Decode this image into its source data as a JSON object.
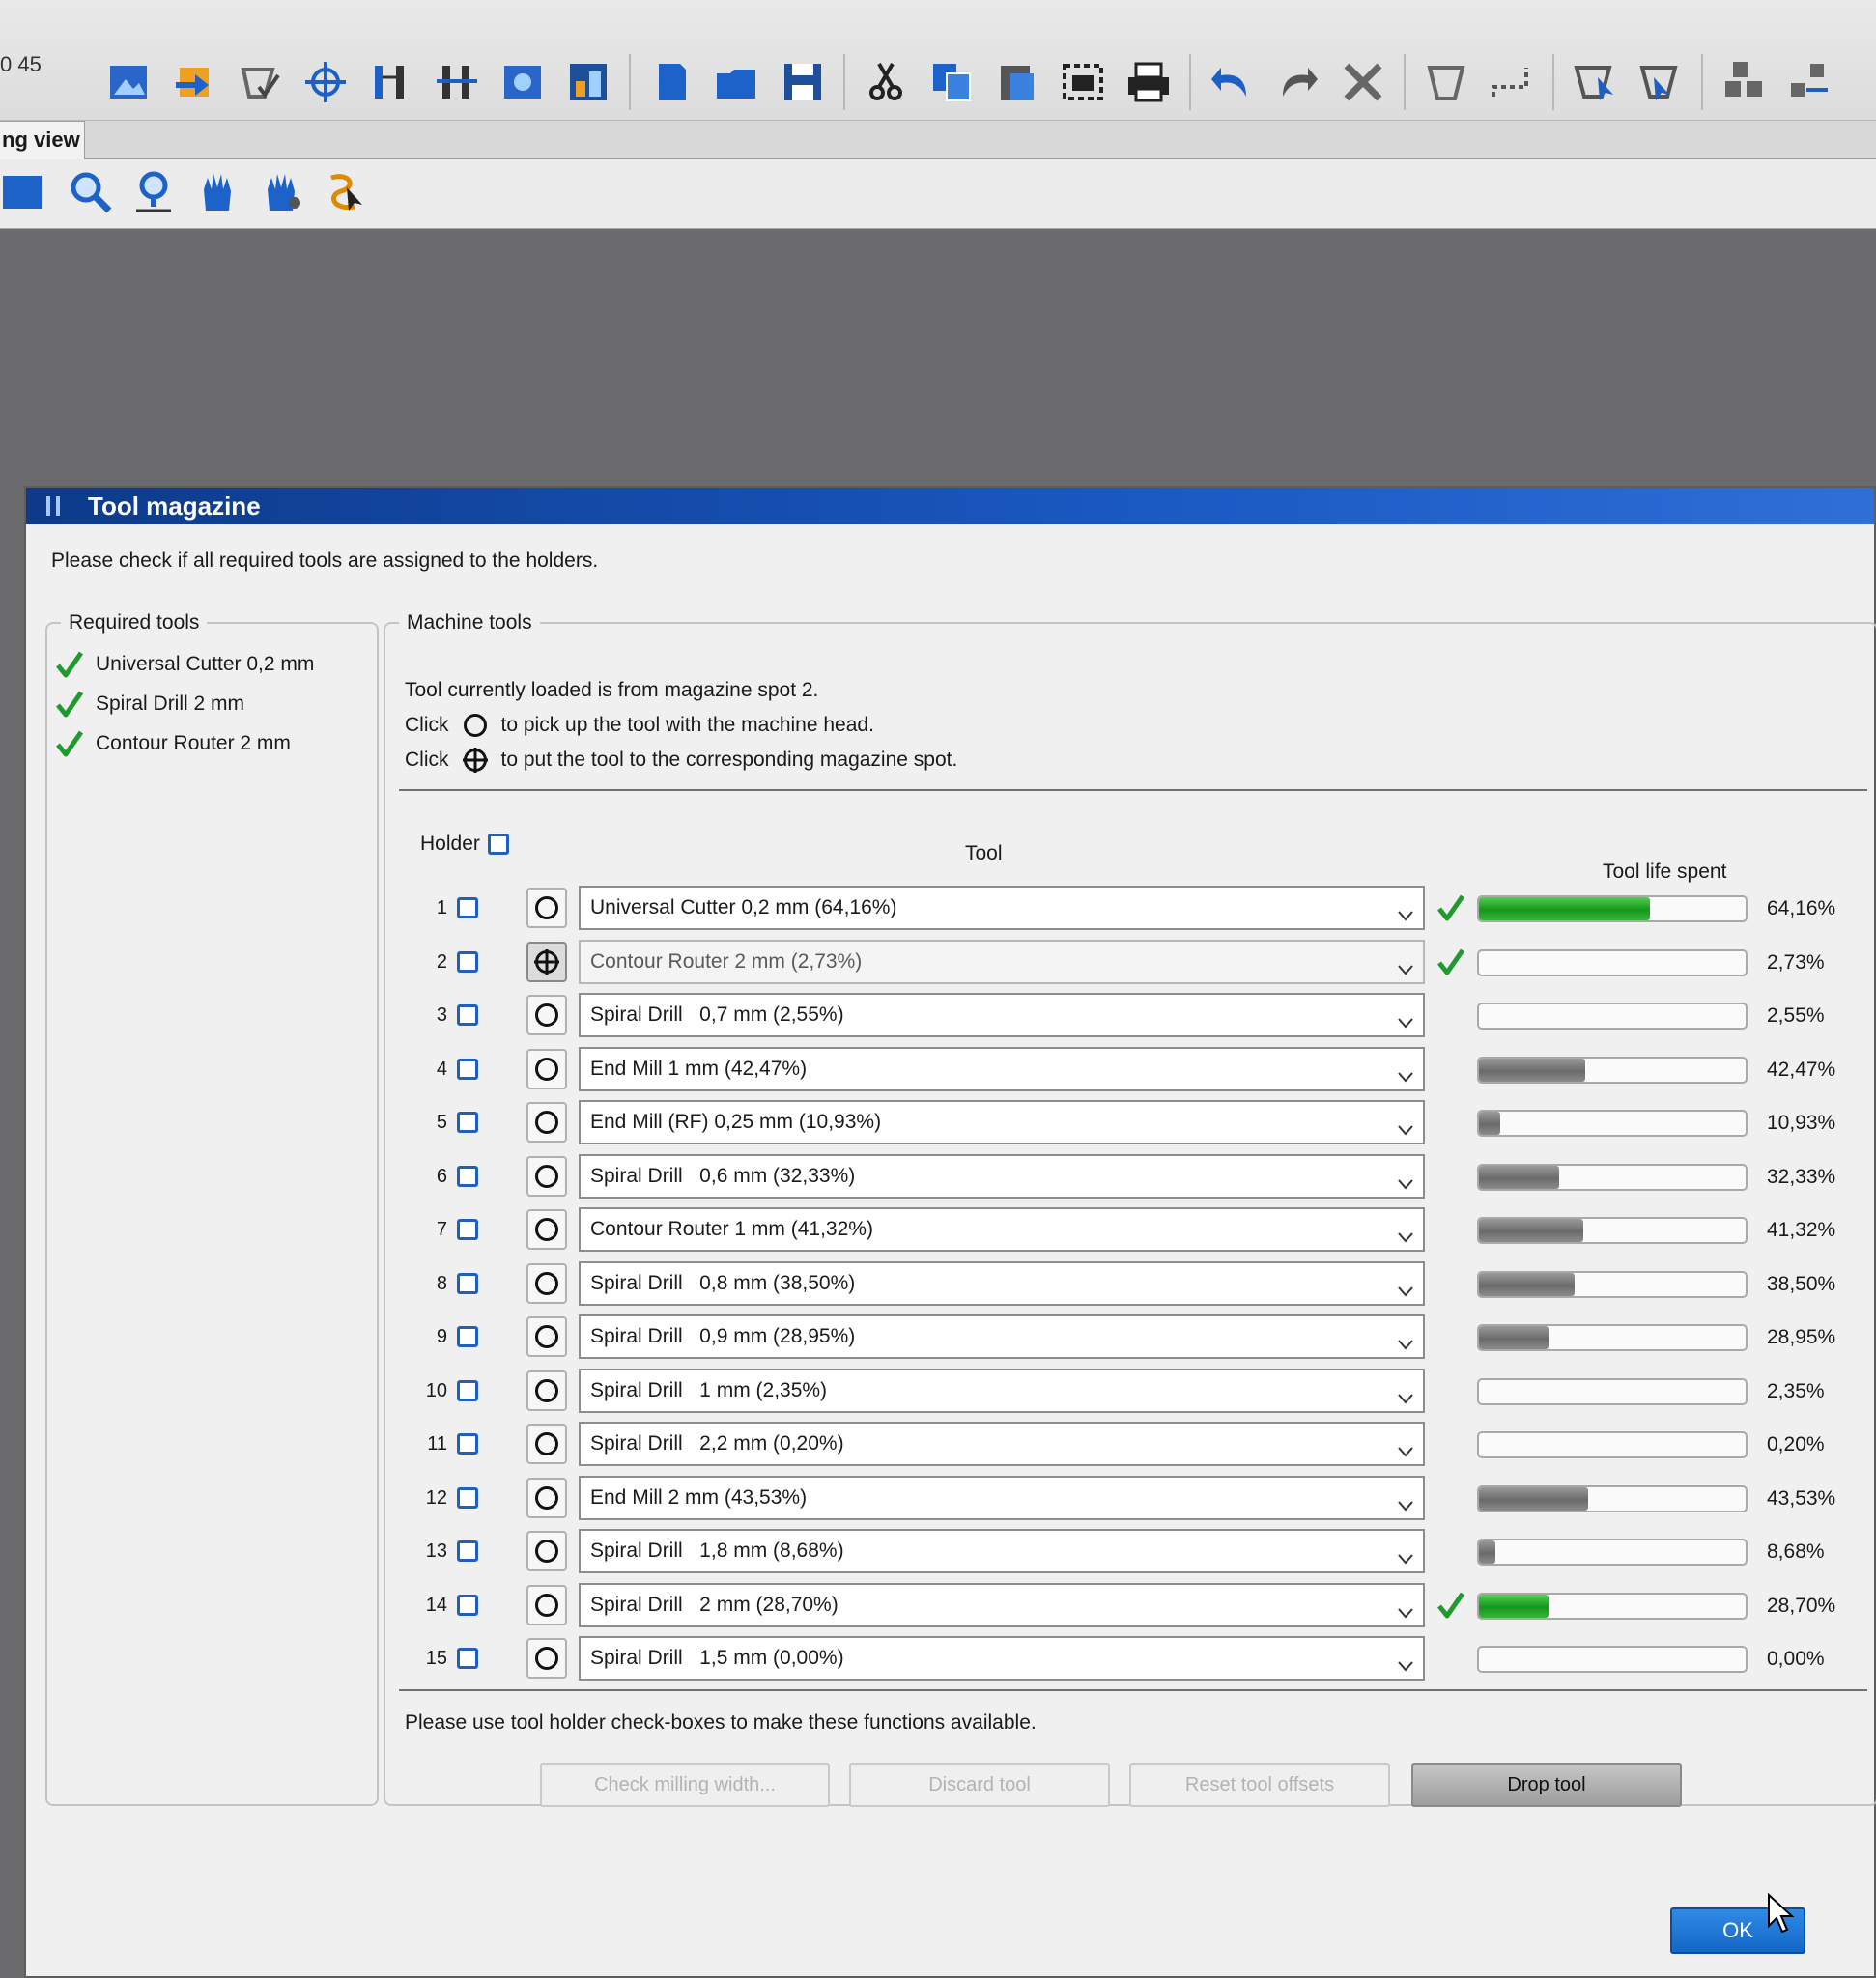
{
  "app": {
    "toolbar_edge_label": "0 45",
    "tab_label": "ng view",
    "toolbar_icons": [
      "image-icon",
      "import-icon",
      "mark-icon",
      "crosshair-icon",
      "measure-icon",
      "align-icon",
      "camera-icon",
      "layers-icon",
      "new-icon",
      "open-icon",
      "save-icon",
      "cut-icon",
      "copy-icon",
      "paste-icon",
      "print-preview-icon",
      "print-icon",
      "undo-icon",
      "redo-icon",
      "delete-icon",
      "select-icon",
      "path-icon",
      "group-icon",
      "ungroup-icon",
      "arrange-icon",
      "distribute-icon"
    ],
    "view_icons": [
      "fit-icon",
      "zoom-icon",
      "zoom-width-icon",
      "pan-icon",
      "pan-hand-icon",
      "snap-icon"
    ]
  },
  "dialog": {
    "title": "Tool magazine",
    "intro": "Please check if all required tools are assigned to the holders.",
    "required": {
      "legend": "Required tools",
      "items": [
        "Universal Cutter 0,2 mm",
        "Spiral Drill   2 mm",
        "Contour Router 2 mm"
      ]
    },
    "machine": {
      "legend": "Machine tools",
      "line1": "Tool currently loaded is from magazine spot 2.",
      "click_word": "Click",
      "line2_rest": "to pick up the tool with the machine head.",
      "line3_rest": "to put the tool to the corresponding magazine spot.",
      "col_holder": "Holder",
      "col_tool": "Tool",
      "col_life": "Tool life spent",
      "rows": [
        {
          "num": "1",
          "tool": "Universal Cutter 0,2 mm (64,16%)",
          "icon": "pick-up-icon",
          "loaded": false,
          "required": true,
          "bar": 64.16,
          "bar_color": "green",
          "pct": "64,16%"
        },
        {
          "num": "2",
          "tool": "Contour Router 2 mm (2,73%)",
          "icon": "put-back-icon",
          "loaded": true,
          "required": true,
          "bar": 0,
          "bar_color": "grey",
          "pct": "2,73%"
        },
        {
          "num": "3",
          "tool": "Spiral Drill   0,7 mm (2,55%)",
          "icon": "pick-up-icon",
          "loaded": false,
          "required": false,
          "bar": 0,
          "bar_color": "grey",
          "pct": "2,55%"
        },
        {
          "num": "4",
          "tool": "End Mill 1 mm (42,47%)",
          "icon": "pick-up-icon",
          "loaded": false,
          "required": false,
          "bar": 40,
          "bar_color": "grey",
          "pct": "42,47%"
        },
        {
          "num": "5",
          "tool": "End Mill (RF) 0,25 mm (10,93%)",
          "icon": "pick-up-icon",
          "loaded": false,
          "required": false,
          "bar": 8,
          "bar_color": "grey",
          "pct": "10,93%"
        },
        {
          "num": "6",
          "tool": "Spiral Drill   0,6 mm (32,33%)",
          "icon": "pick-up-icon",
          "loaded": false,
          "required": false,
          "bar": 30,
          "bar_color": "grey",
          "pct": "32,33%"
        },
        {
          "num": "7",
          "tool": "Contour Router 1 mm (41,32%)",
          "icon": "pick-up-icon",
          "loaded": false,
          "required": false,
          "bar": 39,
          "bar_color": "grey",
          "pct": "41,32%"
        },
        {
          "num": "8",
          "tool": "Spiral Drill   0,8 mm (38,50%)",
          "icon": "pick-up-icon",
          "loaded": false,
          "required": false,
          "bar": 36,
          "bar_color": "grey",
          "pct": "38,50%"
        },
        {
          "num": "9",
          "tool": "Spiral Drill   0,9 mm (28,95%)",
          "icon": "pick-up-icon",
          "loaded": false,
          "required": false,
          "bar": 26,
          "bar_color": "grey",
          "pct": "28,95%"
        },
        {
          "num": "10",
          "tool": "Spiral Drill   1 mm (2,35%)",
          "icon": "pick-up-icon",
          "loaded": false,
          "required": false,
          "bar": 0,
          "bar_color": "grey",
          "pct": "2,35%"
        },
        {
          "num": "11",
          "tool": "Spiral Drill   2,2 mm (0,20%)",
          "icon": "pick-up-icon",
          "loaded": false,
          "required": false,
          "bar": 0,
          "bar_color": "grey",
          "pct": "0,20%"
        },
        {
          "num": "12",
          "tool": "End Mill 2 mm (43,53%)",
          "icon": "pick-up-icon",
          "loaded": false,
          "required": false,
          "bar": 41,
          "bar_color": "grey",
          "pct": "43,53%"
        },
        {
          "num": "13",
          "tool": "Spiral Drill   1,8 mm (8,68%)",
          "icon": "pick-up-icon",
          "loaded": false,
          "required": false,
          "bar": 6,
          "bar_color": "grey",
          "pct": "8,68%"
        },
        {
          "num": "14",
          "tool": "Spiral Drill   2 mm (28,70%)",
          "icon": "pick-up-icon",
          "loaded": false,
          "required": true,
          "bar": 26,
          "bar_color": "green",
          "pct": "28,70%"
        },
        {
          "num": "15",
          "tool": "Spiral Drill   1,5 mm (0,00%)",
          "icon": "pick-up-icon",
          "loaded": false,
          "required": false,
          "bar": 0,
          "bar_color": "grey",
          "pct": "0,00%"
        }
      ],
      "note": "Please use tool holder check-boxes to make these functions available.",
      "buttons": {
        "check_milling": "Check milling width...",
        "discard": "Discard tool",
        "reset_offsets": "Reset tool offsets",
        "drop": "Drop tool"
      }
    },
    "ok": "OK"
  },
  "colors": {
    "accent": "#1f5fbf",
    "title_bar": "#1a58c2",
    "check_green": "#1f9a2c",
    "bar_green": "#16961c",
    "bar_grey": "#6a6a6a"
  }
}
